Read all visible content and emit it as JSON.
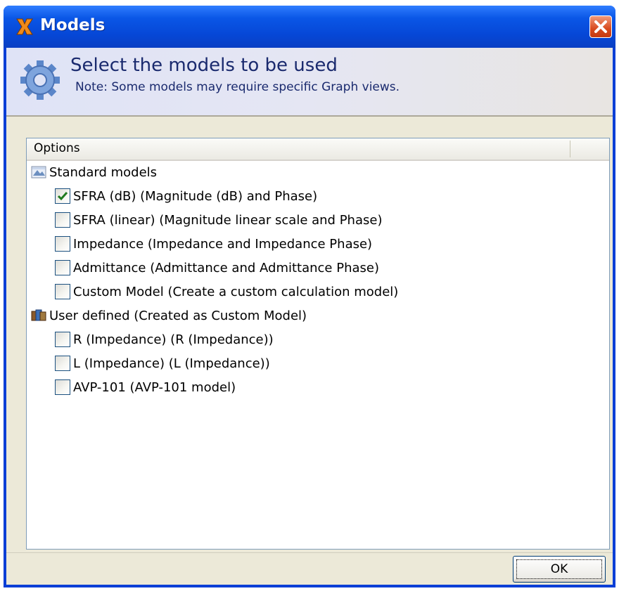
{
  "window": {
    "title": "Models"
  },
  "header": {
    "title": "Select the models to be used",
    "note": "Note: Some models may require specific Graph views."
  },
  "list": {
    "column_header": "Options",
    "groups": [
      {
        "label": "Standard models",
        "icon": "standard-models-icon",
        "items": [
          {
            "label": "SFRA (dB) (Magnitude (dB) and Phase)",
            "checked": true
          },
          {
            "label": "SFRA (linear) (Magnitude linear scale and Phase)",
            "checked": false
          },
          {
            "label": "Impedance (Impedance and Impedance Phase)",
            "checked": false
          },
          {
            "label": "Admittance (Admittance and Admittance Phase)",
            "checked": false
          },
          {
            "label": "Custom Model (Create a custom calculation model)",
            "checked": false
          }
        ]
      },
      {
        "label": "User defined (Created as Custom Model)",
        "icon": "user-defined-icon",
        "items": [
          {
            "label": "R (Impedance) (R (Impedance))",
            "checked": false
          },
          {
            "label": "L (Impedance) (L (Impedance))",
            "checked": false
          },
          {
            "label": "AVP-101 (AVP-101 model)",
            "checked": false
          }
        ]
      }
    ]
  },
  "footer": {
    "ok_label": "OK"
  }
}
